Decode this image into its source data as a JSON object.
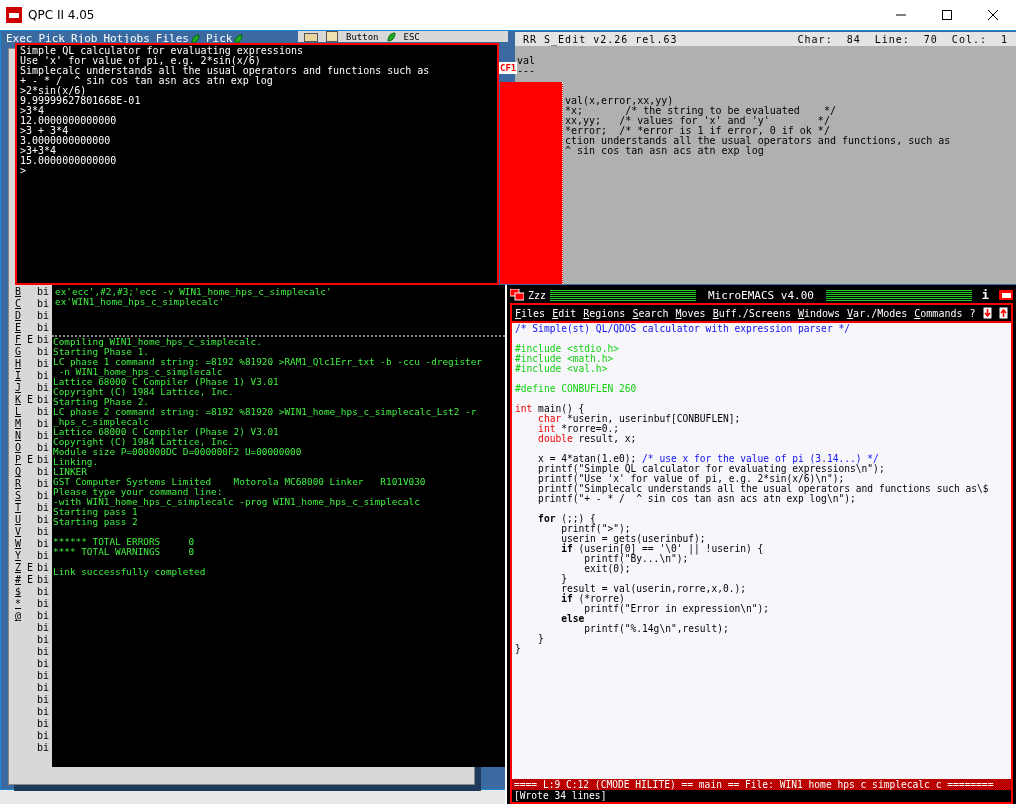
{
  "window": {
    "title": "QPC II 4.05"
  },
  "menu_bar": {
    "items": [
      {
        "label": "Exec",
        "kind": "text"
      },
      {
        "label": "Pick",
        "kind": "text"
      },
      {
        "label": "Rjob",
        "kind": "text"
      },
      {
        "label": "Hotjobs",
        "kind": "text"
      },
      {
        "label": "Files",
        "kind": "icon"
      },
      {
        "label": "Pick",
        "kind": "icon"
      }
    ]
  },
  "toolbar": {
    "button_label": "Button",
    "esc_label": "ESC"
  },
  "file_list": {
    "rows": [
      {
        "letter": "B",
        "name": "bi"
      },
      {
        "letter": "C",
        "name": "bi"
      },
      {
        "letter": "D",
        "name": "bi"
      },
      {
        "letter": "E",
        "name": "bi"
      },
      {
        "letter": "F",
        "flag": "E",
        "name": "bi"
      },
      {
        "letter": "G",
        "name": "bi"
      },
      {
        "letter": "H",
        "name": "bi"
      },
      {
        "letter": "I",
        "name": "bi"
      },
      {
        "letter": "J",
        "name": "bi"
      },
      {
        "letter": "K",
        "flag": "E",
        "name": "bi"
      },
      {
        "letter": "L",
        "name": "bi"
      },
      {
        "letter": "M",
        "name": "bi"
      },
      {
        "letter": "N",
        "name": "bi"
      },
      {
        "letter": "O",
        "name": "bi"
      },
      {
        "letter": "P",
        "flag": "E",
        "name": "bi"
      },
      {
        "letter": "Q",
        "name": "bi"
      },
      {
        "letter": "R",
        "name": "bi"
      },
      {
        "letter": "S",
        "name": "bi"
      },
      {
        "letter": "T",
        "name": "bi"
      },
      {
        "letter": "U",
        "name": "bi"
      },
      {
        "letter": "V",
        "name": "bi"
      },
      {
        "letter": "W",
        "name": "bi"
      },
      {
        "letter": "Y",
        "name": "bi"
      },
      {
        "letter": "Z",
        "flag": "E",
        "name": "bi"
      },
      {
        "letter": "#",
        "flag": "E",
        "name": "bi"
      },
      {
        "letter": "$",
        "name": "bi"
      },
      {
        "letter": "*",
        "name": "bi"
      },
      {
        "letter": "@",
        "name": "bi"
      },
      {
        "name": "bi"
      },
      {
        "name": "bi"
      },
      {
        "name": "bi"
      },
      {
        "name": "bi"
      },
      {
        "name": "bi"
      },
      {
        "name": "bi"
      },
      {
        "name": "bi"
      },
      {
        "name": "bi"
      },
      {
        "name": "bi"
      },
      {
        "name": "bi"
      },
      {
        "name": "bi"
      }
    ]
  },
  "red_panel": {
    "label": "CF1"
  },
  "s_edit": {
    "title": "RR S_Edit v2.26 rel.63",
    "char_label": "Char:",
    "char_value": "84",
    "line_label": "Line:",
    "line_value": "70",
    "col_label": "Col.:",
    "col_value": "1",
    "heading": "val",
    "underline": "---",
    "lines": [
      "val(x,error,xx,yy)",
      "*x;       /* the string to be evaluated    */",
      "xx,yy;   /* values for 'x' and 'y'        */",
      "*error;  /* *error is 1 if error, 0 if ok */",
      "ction understands all the usual operators and functions, such as",
      "^ sin cos tan asn acs atn exp log"
    ]
  },
  "calculator": {
    "lines": [
      "Simple QL calculator for evaluating expressions",
      "Use 'x' for value of pi, e.g. 2*sin(x/6)",
      "Simplecalc understands all the usual operators and functions such as",
      "+ - * /  ^ sin cos tan asn acs atn exp log",
      ">2*sin(x/6)",
      "9.99999627801668E-01",
      ">3*4",
      "12.0000000000000",
      ">3 + 3*4",
      "3.0000000000000",
      ">3+3*4",
      "15.0000000000000",
      ">"
    ]
  },
  "compiler": {
    "commands": [
      "ex'ecc',#2,#3;'ecc -v WIN1_home_hps_c_simplecalc'",
      "ex'WIN1_home_hps_c_simplecalc'"
    ],
    "log": [
      {
        "text": "Compiling WIN1_home_hps_c_simplecalc.",
        "space_before": false
      },
      {
        "text": "Starting Phase 1.",
        "space_before": false
      },
      {
        "text": "LC phase 1 command string: =8192 %81920 >RAM1_Qlc1Err_txt -b -ccu -dregister",
        "space_before": false
      },
      {
        "text": " -n WIN1_home_hps_c_simplecalc",
        "space_before": false
      },
      {
        "text": "Lattice 68000 C Compiler (Phase 1) V3.01",
        "space_before": false
      },
      {
        "text": "Copyright (C) 1984 Lattice, Inc.",
        "space_before": false
      },
      {
        "text": "Starting Phase 2.",
        "space_before": false
      },
      {
        "text": "LC phase 2 command string: =8192 %81920 >WIN1_home_hps_c_simplecalc_Lst2 -r",
        "space_before": false
      },
      {
        "text": "_hps_c_simplecalc",
        "space_before": false
      },
      {
        "text": "Lattice 68000 C Compiler (Phase 2) V3.01",
        "space_before": false
      },
      {
        "text": "Copyright (C) 1984 Lattice, Inc.",
        "space_before": false
      },
      {
        "text": "Module size P=000000DC D=000000F2 U=00000000",
        "space_before": false
      },
      {
        "text": "Linking.",
        "space_before": false
      },
      {
        "text": "LINKER",
        "space_before": false
      },
      {
        "text": "GST Computer Systems Limited    Motorola MC68000 Linker   R101V030",
        "space_before": false
      },
      {
        "text": "Please type your command line:",
        "space_before": false
      },
      {
        "text": "-with WIN1_home_hps_c_simplecalc -prog WIN1_home_hps_c_simplecalc",
        "space_before": false
      },
      {
        "text": "Starting pass 1",
        "space_before": false
      },
      {
        "text": "Starting pass 2",
        "space_before": false
      },
      {
        "text": "****** TOTAL ERRORS     0",
        "space_before": true
      },
      {
        "text": "**** TOTAL WARNINGS     0",
        "space_before": false
      },
      {
        "text": "Link successfully completed",
        "space_before": true
      }
    ]
  },
  "emacs": {
    "job": "Zzz",
    "title": "MicroEMACS v4.00",
    "info": "i",
    "menu": [
      "Files",
      "Edit",
      "Regions",
      "Search",
      "Moves",
      "Buff./Screens",
      "Windows",
      "Var./Modes",
      "Commands",
      "?"
    ],
    "lines": [
      {
        "space_before": false,
        "segments": [
          {
            "text": "/* Simple(st) QL/QDOS calculator with expression parser */",
            "kind": "comment"
          }
        ]
      },
      {
        "space_before": true,
        "segments": [
          {
            "text": "#include <stdio.h>",
            "kind": "preproc"
          }
        ]
      },
      {
        "space_before": false,
        "segments": [
          {
            "text": "#include <math.h>",
            "kind": "preproc"
          }
        ]
      },
      {
        "space_before": false,
        "segments": [
          {
            "text": "#include <val.h>",
            "kind": "preproc"
          }
        ]
      },
      {
        "space_before": true,
        "segments": [
          {
            "text": "#define CONBUFLEN 260",
            "kind": "preproc"
          }
        ]
      },
      {
        "space_before": true,
        "segments": [
          {
            "text": "int",
            "kind": "type"
          },
          {
            "text": " main() {",
            "kind": "plain"
          }
        ]
      },
      {
        "space_before": false,
        "segments": [
          {
            "text": "    char",
            "kind": "type"
          },
          {
            "text": " *userin, userinbuf[CONBUFLEN];",
            "kind": "plain"
          }
        ]
      },
      {
        "space_before": false,
        "segments": [
          {
            "text": "    int",
            "kind": "type"
          },
          {
            "text": " *rorre=0.;",
            "kind": "plain"
          }
        ]
      },
      {
        "space_before": false,
        "segments": [
          {
            "text": "    double",
            "kind": "type"
          },
          {
            "text": " result, x;",
            "kind": "plain"
          }
        ]
      },
      {
        "space_before": true,
        "segments": [
          {
            "text": "    x = 4*atan(1.e0); ",
            "kind": "plain"
          },
          {
            "text": "/* use x for the value of pi (3.14...) */",
            "kind": "comment"
          }
        ]
      },
      {
        "space_before": false,
        "segments": [
          {
            "text": "    printf(\"Simple QL calculator for evaluating expressions\\n\");",
            "kind": "plain"
          }
        ]
      },
      {
        "space_before": false,
        "segments": [
          {
            "text": "    printf(\"Use 'x' for value of pi, e.g. 2*sin(x/6)\\n\");",
            "kind": "plain"
          }
        ]
      },
      {
        "space_before": false,
        "segments": [
          {
            "text": "    printf(\"Simplecalc understands all the usual operators and functions such as\\$",
            "kind": "plain"
          }
        ]
      },
      {
        "space_before": false,
        "segments": [
          {
            "text": "    printf(\"+ - * /  ^ sin cos tan asn acs atn exp log\\n\");",
            "kind": "plain"
          }
        ]
      },
      {
        "space_before": true,
        "segments": [
          {
            "text": "    for",
            "kind": "keyword"
          },
          {
            "text": " (;;) {",
            "kind": "plain"
          }
        ]
      },
      {
        "space_before": false,
        "segments": [
          {
            "text": "        printf(\">\");",
            "kind": "plain"
          }
        ]
      },
      {
        "space_before": false,
        "segments": [
          {
            "text": "        userin = gets(userinbuf);",
            "kind": "plain"
          }
        ]
      },
      {
        "space_before": false,
        "segments": [
          {
            "text": "        if",
            "kind": "keyword"
          },
          {
            "text": " (userin[0] == '\\0' || !userin) {",
            "kind": "plain"
          }
        ]
      },
      {
        "space_before": false,
        "segments": [
          {
            "text": "            printf(\"By...\\n\");",
            "kind": "plain"
          }
        ]
      },
      {
        "space_before": false,
        "segments": [
          {
            "text": "            exit(0);",
            "kind": "plain"
          }
        ]
      },
      {
        "space_before": false,
        "segments": [
          {
            "text": "        }",
            "kind": "plain"
          }
        ]
      },
      {
        "space_before": false,
        "segments": [
          {
            "text": "        result = val(userin,rorre,x,0.);",
            "kind": "plain"
          }
        ]
      },
      {
        "space_before": false,
        "segments": [
          {
            "text": "        if",
            "kind": "keyword"
          },
          {
            "text": " (*rorre)",
            "kind": "plain"
          }
        ]
      },
      {
        "space_before": false,
        "segments": [
          {
            "text": "            printf(\"Error in expression\\n\");",
            "kind": "plain"
          }
        ]
      },
      {
        "space_before": false,
        "segments": [
          {
            "text": "        else",
            "kind": "keyword"
          }
        ]
      },
      {
        "space_before": false,
        "segments": [
          {
            "text": "            printf(\"%.14g\\n\",result);",
            "kind": "plain"
          }
        ]
      },
      {
        "space_before": false,
        "segments": [
          {
            "text": "    }",
            "kind": "plain"
          }
        ]
      },
      {
        "space_before": false,
        "segments": [
          {
            "text": "}",
            "kind": "plain"
          }
        ]
      }
    ],
    "status": "==== L:9 C:12 (CMODE HILITE) == main == File: WIN1_home_hps_c_simplecalc_c ========",
    "message": "[Wrote 34 lines]"
  }
}
